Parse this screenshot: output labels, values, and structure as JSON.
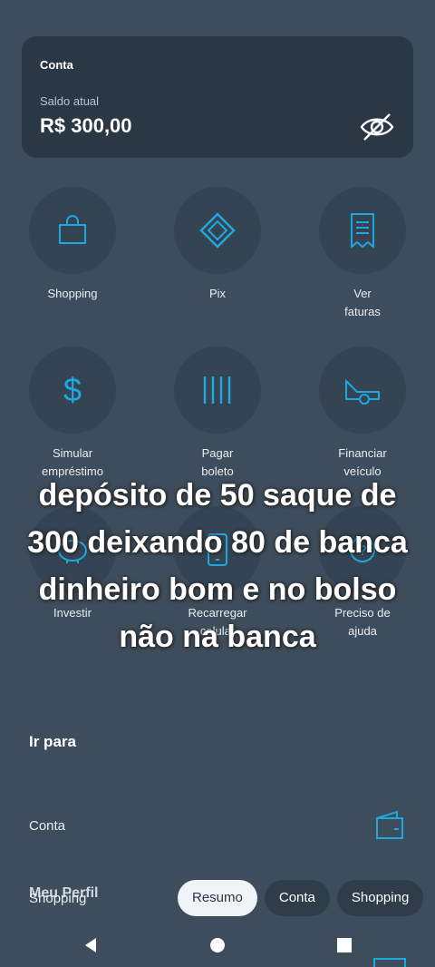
{
  "account": {
    "title": "Conta",
    "balance_label": "Saldo atual",
    "balance": "R$ 300,00",
    "visibility_icon": "eye-off-icon"
  },
  "actions": [
    {
      "label": "Shopping",
      "icon": "shopping-bag-icon"
    },
    {
      "label": "Pix",
      "icon": "pix-icon"
    },
    {
      "label": "Ver faturas",
      "icon": "receipt-icon"
    },
    {
      "label": "Simular empréstimo",
      "icon": "dollar-icon"
    },
    {
      "label": "Pagar boleto",
      "icon": "barcode-icon"
    },
    {
      "label": "Financiar veículo",
      "icon": "car-icon"
    },
    {
      "label": "Investir",
      "icon": "piggy-bank-icon"
    },
    {
      "label": "Recarregar celular",
      "icon": "phone-icon"
    },
    {
      "label": "Preciso de ajuda",
      "icon": "help-icon"
    }
  ],
  "overlay_caption": "depósito de 50 saque de 300 deixando 80 de banca dinheiro bom e no bolso não na banca",
  "shortcuts": {
    "title": "Ir para",
    "items": [
      {
        "label": "Conta",
        "icon": "wallet-icon"
      },
      {
        "label": "Shopping",
        "icon": "shopping-icon"
      }
    ],
    "partial_text": "Meu Perfil"
  },
  "tabs": [
    {
      "label": "Resumo",
      "active": true
    },
    {
      "label": "Conta",
      "active": false
    },
    {
      "label": "Shopping",
      "active": false
    }
  ],
  "colors": {
    "background": "#3e4d5c",
    "card": "#2a3744",
    "accent": "#1ea7e1"
  }
}
